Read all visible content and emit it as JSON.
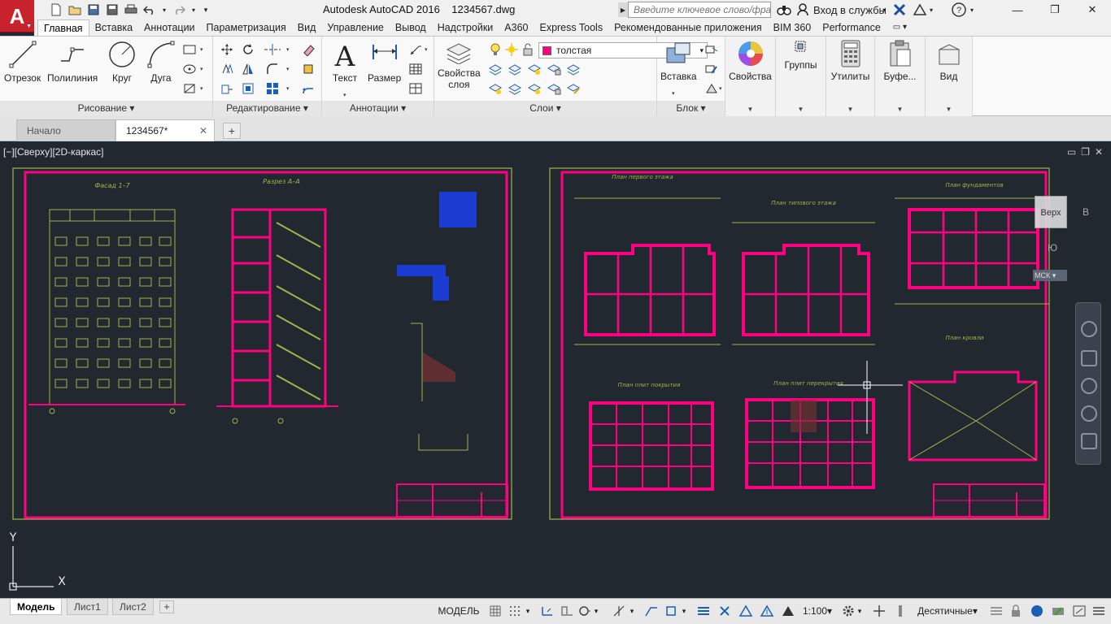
{
  "app": {
    "title": "Autodesk AutoCAD 2016    1234567.dwg",
    "search_placeholder": "Введите ключевое слово/фразу",
    "signin_label": "Вход в службы"
  },
  "ribbon_tabs": [
    "Главная",
    "Вставка",
    "Аннотации",
    "Параметризация",
    "Вид",
    "Управление",
    "Вывод",
    "Надстройки",
    "A360",
    "Express Tools",
    "Рекомендованные приложения",
    "BIM 360",
    "Performance"
  ],
  "panels": {
    "draw": {
      "title": "Рисование",
      "tools": [
        "Отрезок",
        "Полилиния",
        "Круг",
        "Дуга"
      ]
    },
    "modify": {
      "title": "Редактирование"
    },
    "annotation": {
      "title": "Аннотации",
      "tools": [
        "Текст",
        "Размер"
      ]
    },
    "layers": {
      "title": "Слои",
      "props_label": "Свойства",
      "props_label2": "слоя",
      "current_layer": "толстая"
    },
    "block": {
      "title": "Блок",
      "insert_label": "Вставка"
    },
    "properties": {
      "label": "Свойства"
    },
    "groups": {
      "label": "Группы"
    },
    "utilities": {
      "label": "Утилиты"
    },
    "clipboard": {
      "label": "Буфе..."
    },
    "view": {
      "label": "Вид"
    }
  },
  "file_tabs": {
    "start": "Начало",
    "document": "1234567*"
  },
  "viewport": {
    "label": "[−][Сверху][2D-каркас]",
    "viewcube_face": "Верх",
    "viewcube_w": "В",
    "viewcube_s": "Ю",
    "ucs_label": "МСК",
    "axis_x": "X",
    "axis_y": "Y"
  },
  "sheets": {
    "left": {
      "facade_title": "Фасад 1–7",
      "section_title": "Разрез А–А"
    },
    "right": {
      "plan1": "План первого этажа",
      "plan_typ": "План типового этажа",
      "plan_found": "План фундаментов",
      "plan_roof_slab": "План плит покрытия",
      "plan_floor_slab": "План плит перекрытия",
      "plan_roof": "План кровли"
    }
  },
  "layout_tabs": [
    "Модель",
    "Лист1",
    "Лист2"
  ],
  "status": {
    "model": "МОДЕЛЬ",
    "scale": "1:100",
    "units": "Десятичные"
  },
  "colors": {
    "accent_magenta": "#ff0080",
    "drawing_line": "#a0b44a",
    "background": "#212830",
    "app_red": "#c8232c"
  }
}
